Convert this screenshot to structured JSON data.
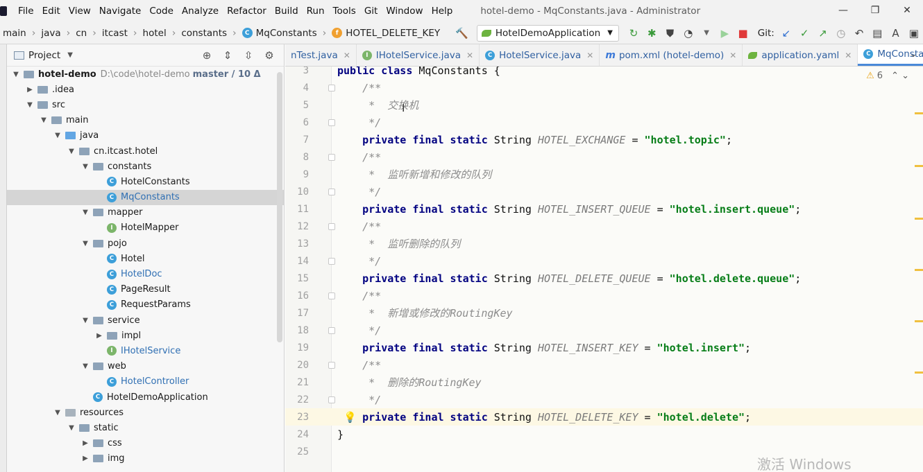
{
  "menubar": {
    "items": [
      "File",
      "Edit",
      "View",
      "Navigate",
      "Code",
      "Analyze",
      "Refactor",
      "Build",
      "Run",
      "Tools",
      "Git",
      "Window",
      "Help"
    ],
    "title": "hotel-demo - MqConstants.java - Administrator"
  },
  "navbar": {
    "crumbs": [
      "main",
      "java",
      "cn",
      "itcast",
      "hotel",
      "constants",
      "MqConstants",
      "HOTEL_DELETE_KEY"
    ],
    "run_config": "HotelDemoApplication",
    "git_label": "Git:"
  },
  "project_panel": {
    "title": "Project",
    "tree": [
      {
        "label": "hotel-demo",
        "path": "D:\\code\\hotel-demo",
        "branch": "master / 10 Δ"
      },
      {
        "label": ".idea"
      },
      {
        "label": "src"
      },
      {
        "label": "main"
      },
      {
        "label": "java"
      },
      {
        "label": "cn.itcast.hotel"
      },
      {
        "label": "constants"
      },
      {
        "label": "HotelConstants"
      },
      {
        "label": "MqConstants"
      },
      {
        "label": "mapper"
      },
      {
        "label": "HotelMapper"
      },
      {
        "label": "pojo"
      },
      {
        "label": "Hotel"
      },
      {
        "label": "HotelDoc"
      },
      {
        "label": "PageResult"
      },
      {
        "label": "RequestParams"
      },
      {
        "label": "service"
      },
      {
        "label": "impl"
      },
      {
        "label": "IHotelService"
      },
      {
        "label": "web"
      },
      {
        "label": "HotelController"
      },
      {
        "label": "HotelDemoApplication"
      },
      {
        "label": "resources"
      },
      {
        "label": "static"
      },
      {
        "label": "css"
      },
      {
        "label": "img"
      }
    ]
  },
  "editor": {
    "tabs": [
      "nTest.java",
      "IHotelService.java",
      "HotelService.java",
      "pom.xml (hotel-demo)",
      "application.yaml",
      "MqConstants.java"
    ],
    "warnings": "6",
    "lines": [
      {
        "n": "3",
        "parts": [
          [
            "kw",
            "public class "
          ],
          [
            "",
            "MqConstants {"
          ]
        ]
      },
      {
        "n": "4",
        "parts": [
          [
            "cmt",
            "    /**"
          ]
        ]
      },
      {
        "n": "5",
        "parts": [
          [
            "cmt",
            "     *  交换机"
          ]
        ]
      },
      {
        "n": "6",
        "parts": [
          [
            "cmt",
            "     */"
          ]
        ]
      },
      {
        "n": "7",
        "parts": [
          [
            "kw",
            "    private final static "
          ],
          [
            "",
            "String "
          ],
          [
            "cnst",
            "HOTEL_EXCHANGE"
          ],
          [
            "",
            " = "
          ],
          [
            "str",
            "\"hotel.topic\""
          ],
          [
            "",
            ";"
          ]
        ]
      },
      {
        "n": "8",
        "parts": [
          [
            "cmt",
            "    /**"
          ]
        ]
      },
      {
        "n": "9",
        "parts": [
          [
            "cmt",
            "     *  监听新增和修改的队列"
          ]
        ]
      },
      {
        "n": "10",
        "parts": [
          [
            "cmt",
            "     */"
          ]
        ]
      },
      {
        "n": "11",
        "parts": [
          [
            "kw",
            "    private final static "
          ],
          [
            "",
            "String "
          ],
          [
            "cnst",
            "HOTEL_INSERT_QUEUE"
          ],
          [
            "",
            " = "
          ],
          [
            "str",
            "\"hotel.insert.queue\""
          ],
          [
            "",
            ";"
          ]
        ]
      },
      {
        "n": "12",
        "parts": [
          [
            "cmt",
            "    /**"
          ]
        ]
      },
      {
        "n": "13",
        "parts": [
          [
            "cmt",
            "     *  监听删除的队列"
          ]
        ]
      },
      {
        "n": "14",
        "parts": [
          [
            "cmt",
            "     */"
          ]
        ]
      },
      {
        "n": "15",
        "parts": [
          [
            "kw",
            "    private final static "
          ],
          [
            "",
            "String "
          ],
          [
            "cnst",
            "HOTEL_DELETE_QUEUE"
          ],
          [
            "",
            " = "
          ],
          [
            "str",
            "\"hotel.delete.queue\""
          ],
          [
            "",
            ";"
          ]
        ]
      },
      {
        "n": "16",
        "parts": [
          [
            "cmt",
            "    /**"
          ]
        ]
      },
      {
        "n": "17",
        "parts": [
          [
            "cmt",
            "     *  新增或修改的RoutingKey"
          ]
        ]
      },
      {
        "n": "18",
        "parts": [
          [
            "cmt",
            "     */"
          ]
        ]
      },
      {
        "n": "19",
        "parts": [
          [
            "kw",
            "    private final static "
          ],
          [
            "",
            "String "
          ],
          [
            "cnst",
            "HOTEL_INSERT_KEY"
          ],
          [
            "",
            " = "
          ],
          [
            "str",
            "\"hotel.insert\""
          ],
          [
            "",
            ";"
          ]
        ]
      },
      {
        "n": "20",
        "parts": [
          [
            "cmt",
            "    /**"
          ]
        ]
      },
      {
        "n": "21",
        "parts": [
          [
            "cmt",
            "     *  删除的RoutingKey"
          ]
        ]
      },
      {
        "n": "22",
        "parts": [
          [
            "cmt",
            "     */"
          ]
        ]
      },
      {
        "n": "23",
        "parts": [
          [
            "kw",
            "    private final static "
          ],
          [
            "",
            "String "
          ],
          [
            "cnst",
            "HOTEL_DELETE_KEY"
          ],
          [
            "",
            " = "
          ],
          [
            "str",
            "\"hotel.delete\""
          ],
          [
            "",
            ";"
          ]
        ]
      },
      {
        "n": "24",
        "parts": [
          [
            "",
            "}"
          ]
        ]
      },
      {
        "n": "25",
        "parts": []
      }
    ]
  },
  "watermark": "激活 Windows"
}
